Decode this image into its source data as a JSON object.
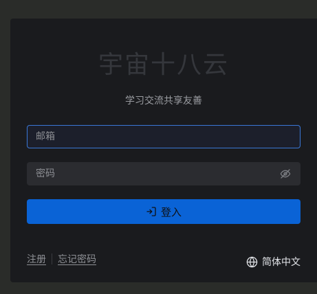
{
  "app": {
    "title": "宇宙十八云",
    "subtitle": "学习交流共享友善"
  },
  "form": {
    "email_placeholder": "邮箱",
    "password_placeholder": "密码",
    "login_label": "登入"
  },
  "links": {
    "register": "注册",
    "forgot_password": "忘记密码"
  },
  "language": {
    "label": "简体中文"
  },
  "icons": {
    "eye": "eye-off-icon",
    "login": "login-icon",
    "globe": "globe-icon"
  },
  "colors": {
    "primary": "#0a63d6",
    "focus_border": "#3a78d8",
    "card_bg": "#1a1b1e",
    "page_bg": "#2a2c29"
  }
}
